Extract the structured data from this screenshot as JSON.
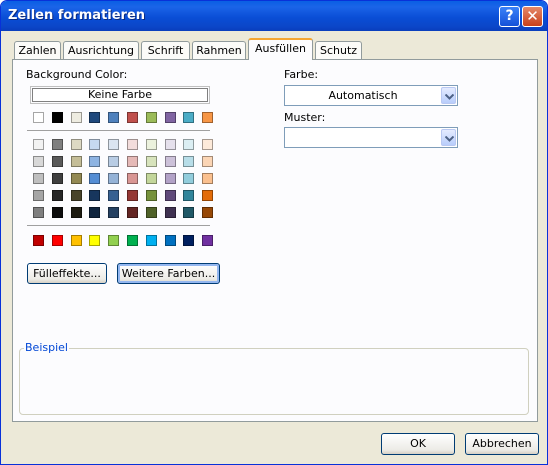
{
  "window": {
    "title": "Zellen formatieren",
    "help_label": "?",
    "close_label": "✕"
  },
  "tabs": [
    {
      "label": "Zahlen",
      "active": false
    },
    {
      "label": "Ausrichtung",
      "active": false
    },
    {
      "label": "Schrift",
      "active": false
    },
    {
      "label": "Rahmen",
      "active": false
    },
    {
      "label": "Ausfüllen",
      "active": true
    },
    {
      "label": "Schutz",
      "active": false
    }
  ],
  "fill": {
    "background_label": "Background Color:",
    "no_color_label": "Keine Farbe",
    "theme_row": [
      "#ffffff",
      "#000000",
      "#eeece1",
      "#1f497d",
      "#4f81bd",
      "#c0504d",
      "#9bbb59",
      "#8064a2",
      "#4bacc6",
      "#f79646"
    ],
    "tint_rows": [
      [
        "#f2f2f2",
        "#7f7f7f",
        "#ddd9c3",
        "#c6d9f0",
        "#dbe5f1",
        "#f2dcdb",
        "#ebf1dd",
        "#e5e0ec",
        "#dbeef3",
        "#fdeada"
      ],
      [
        "#d8d8d8",
        "#595959",
        "#c4bd97",
        "#8db3e2",
        "#b8cce4",
        "#e5b9b7",
        "#d7e3bc",
        "#ccc1d9",
        "#b7dde8",
        "#fbd5b5"
      ],
      [
        "#bfbfbf",
        "#3f3f3f",
        "#938953",
        "#548dd4",
        "#95b3d7",
        "#d99694",
        "#c3d69b",
        "#b2a2c7",
        "#92cddc",
        "#fac08f"
      ],
      [
        "#a5a5a5",
        "#262626",
        "#494429",
        "#17365d",
        "#366092",
        "#953734",
        "#76923c",
        "#5f497a",
        "#31859b",
        "#e36c09"
      ],
      [
        "#7f7f7f",
        "#0c0c0c",
        "#1d1b10",
        "#0f243e",
        "#244061",
        "#632423",
        "#4f6128",
        "#3f3151",
        "#205867",
        "#974806"
      ]
    ],
    "standard_row": [
      "#c00000",
      "#ff0000",
      "#ffc000",
      "#ffff00",
      "#92d050",
      "#00b050",
      "#00b0f0",
      "#0070c0",
      "#002060",
      "#7030a0"
    ],
    "fill_effects_label": "Fülleffekte...",
    "more_colors_label": "Weitere Farben...",
    "color_label": "Farbe:",
    "color_value": "Automatisch",
    "pattern_label": "Muster:",
    "pattern_value": "",
    "sample_label": "Beispiel"
  },
  "footer": {
    "ok_label": "OK",
    "cancel_label": "Abbrechen"
  }
}
